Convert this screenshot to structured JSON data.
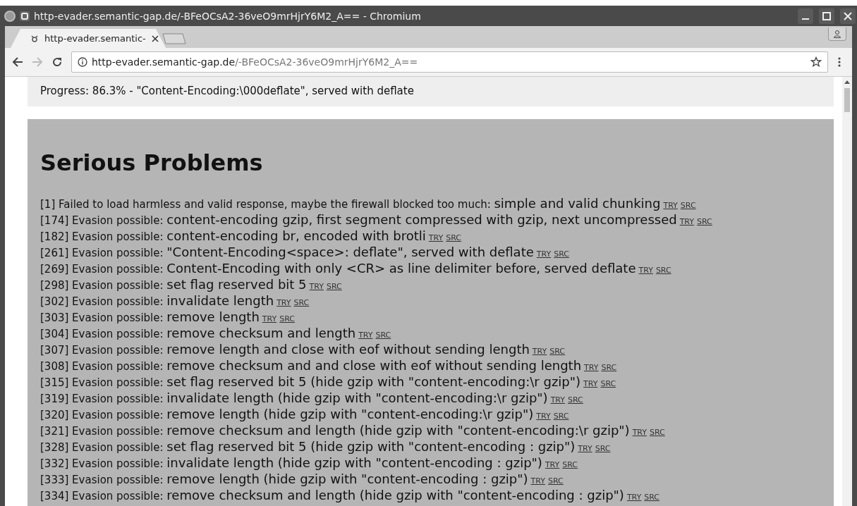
{
  "window": {
    "title": "http-evader.semantic-gap.de/-BFeOCsA2-36veO9mrHjrY6M2_A== - Chromium"
  },
  "tabs": [
    {
      "label": "http-evader.semantic-",
      "selected": true
    }
  ],
  "address_bar": {
    "host": "http-evader.semantic-gap.de",
    "path": "/-BFeOCsA2-36veO9mrHjrY6M2_A=="
  },
  "progress": "Progress: 86.3% - \"Content-Encoding:\\000deflate\", served with deflate",
  "section": {
    "heading": "Serious Problems",
    "items": [
      {
        "prefix": "[1] Failed to load harmless and valid response, maybe the firewall blocked too much:",
        "text": "simple and valid chunking",
        "links": [
          "TRY",
          "SRC"
        ]
      },
      {
        "prefix": "[174] Evasion possible:",
        "text": "content-encoding gzip, first segment compressed with gzip, next uncompressed",
        "links": [
          "TRY",
          "SRC"
        ]
      },
      {
        "prefix": "[182] Evasion possible:",
        "text": "content-encoding br, encoded with brotli",
        "links": [
          "TRY",
          "SRC"
        ]
      },
      {
        "prefix": "[261] Evasion possible:",
        "text": "\"Content-Encoding<space>: deflate\", served with deflate",
        "links": [
          "TRY",
          "SRC"
        ]
      },
      {
        "prefix": "[269] Evasion possible:",
        "text": "Content-Encoding with only <CR> as line delimiter before, served deflate",
        "links": [
          "TRY",
          "SRC"
        ]
      },
      {
        "prefix": "[298] Evasion possible:",
        "text": "set flag reserved bit 5",
        "links": [
          "TRY",
          "SRC"
        ]
      },
      {
        "prefix": "[302] Evasion possible:",
        "text": "invalidate length",
        "links": [
          "TRY",
          "SRC"
        ]
      },
      {
        "prefix": "[303] Evasion possible:",
        "text": "remove length",
        "links": [
          "TRY",
          "SRC"
        ]
      },
      {
        "prefix": "[304] Evasion possible:",
        "text": "remove checksum and length",
        "links": [
          "TRY",
          "SRC"
        ]
      },
      {
        "prefix": "[307] Evasion possible:",
        "text": "remove length and close with eof without sending length",
        "links": [
          "TRY",
          "SRC"
        ]
      },
      {
        "prefix": "[308] Evasion possible:",
        "text": "remove checksum and and close with eof without sending length",
        "links": [
          "TRY",
          "SRC"
        ]
      },
      {
        "prefix": "[315] Evasion possible:",
        "text": "set flag reserved bit 5 (hide gzip with \"content-encoding:\\r gzip\")",
        "links": [
          "TRY",
          "SRC"
        ]
      },
      {
        "prefix": "[319] Evasion possible:",
        "text": "invalidate length (hide gzip with \"content-encoding:\\r gzip\")",
        "links": [
          "TRY",
          "SRC"
        ]
      },
      {
        "prefix": "[320] Evasion possible:",
        "text": "remove length (hide gzip with \"content-encoding:\\r gzip\")",
        "links": [
          "TRY",
          "SRC"
        ]
      },
      {
        "prefix": "[321] Evasion possible:",
        "text": "remove checksum and length (hide gzip with \"content-encoding:\\r gzip\")",
        "links": [
          "TRY",
          "SRC"
        ]
      },
      {
        "prefix": "[328] Evasion possible:",
        "text": "set flag reserved bit 5 (hide gzip with \"content-encoding : gzip\")",
        "links": [
          "TRY",
          "SRC"
        ]
      },
      {
        "prefix": "[332] Evasion possible:",
        "text": "invalidate length (hide gzip with \"content-encoding : gzip\")",
        "links": [
          "TRY",
          "SRC"
        ]
      },
      {
        "prefix": "[333] Evasion possible:",
        "text": "remove length (hide gzip with \"content-encoding : gzip\")",
        "links": [
          "TRY",
          "SRC"
        ]
      },
      {
        "prefix": "[334] Evasion possible:",
        "text": "remove checksum and length (hide gzip with \"content-encoding : gzip\")",
        "links": [
          "TRY",
          "SRC"
        ]
      }
    ]
  }
}
